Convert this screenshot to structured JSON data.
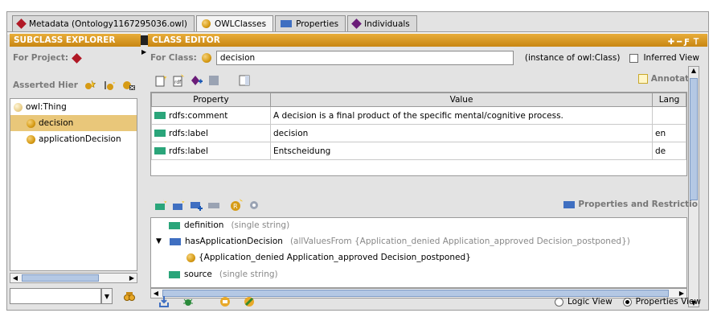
{
  "tabs": [
    {
      "label": "Metadata (Ontology1167295036.owl)",
      "icon": "red-diamond-icon"
    },
    {
      "label": "OWLClasses",
      "icon": "class-ball-icon",
      "active": true
    },
    {
      "label": "Properties",
      "icon": "property-rect-icon"
    },
    {
      "label": "Individuals",
      "icon": "purple-diamond-icon"
    }
  ],
  "subclass_explorer": {
    "title": "SUBCLASS EXPLORER",
    "for_project_label": "For Project:",
    "asserted_label": "Asserted Hier",
    "tree": [
      {
        "label": "owl:Thing",
        "level": 0
      },
      {
        "label": "decision",
        "level": 1,
        "selected": true
      },
      {
        "label": "applicationDecision",
        "level": 1
      }
    ],
    "search_value": ""
  },
  "class_editor": {
    "title": "CLASS EDITOR",
    "for_class_label": "For Class:",
    "class_name": "decision",
    "instance_of": "(instance of owl:Class)",
    "inferred_view_label": "Inferred View",
    "annotations_label": "Annotatio",
    "table": {
      "columns": [
        "Property",
        "Value",
        "Lang"
      ],
      "rows": [
        {
          "property": "rdfs:comment",
          "value": "A decision is a final product of the specific mental/cognitive process.",
          "lang": ""
        },
        {
          "property": "rdfs:label",
          "value": "decision",
          "lang": "en"
        },
        {
          "property": "rdfs:label",
          "value": "Entscheidung",
          "lang": "de"
        }
      ]
    },
    "properties_label": "Properties and Restrictio",
    "properties": [
      {
        "name": "definition",
        "detail": "(single string)"
      },
      {
        "name": "hasApplicationDecision",
        "detail": "(allValuesFrom {Application_denied Application_approved Decision_postponed})",
        "expanded": true
      },
      {
        "name": "{Application_denied Application_approved Decision_postponed}",
        "detail": "",
        "child": true
      },
      {
        "name": "source",
        "detail": "(single string)"
      }
    ],
    "logic_view_label": "Logic View",
    "properties_view_label": "Properties View",
    "selected_view": "properties"
  },
  "colors": {
    "header": "#d99a22",
    "selected": "#e9c77a",
    "class": "#d69b15"
  }
}
